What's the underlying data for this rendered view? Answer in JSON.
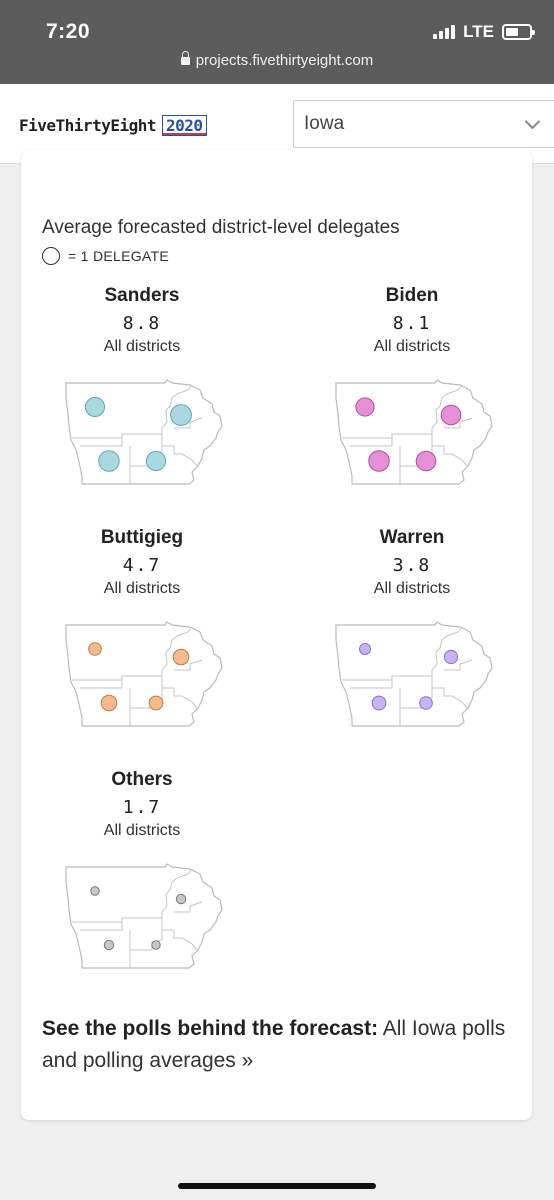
{
  "status_bar": {
    "time": "7:20",
    "network": "LTE",
    "url": "projects.fivethirtyeight.com"
  },
  "header": {
    "logo_text": "FiveThirtyEight",
    "logo_year": "2020",
    "state_selected": "Iowa"
  },
  "card": {
    "heading": "Average forecasted district-level delegates",
    "legend_label": "= 1 DELEGATE",
    "candidates": [
      {
        "name": "Sanders",
        "value": "8.8",
        "sub": "All districts",
        "color": "#a9d8e0",
        "stroke": "#5fa8b8",
        "district_delegates": [
          2.1,
          2.5,
          2.4,
          2.1
        ]
      },
      {
        "name": "Biden",
        "value": "8.1",
        "sub": "All districts",
        "color": "#e58fd4",
        "stroke": "#b34aa0",
        "district_delegates": [
          1.9,
          2.2,
          2.4,
          2.2
        ]
      },
      {
        "name": "Buttigieg",
        "value": "4.7",
        "sub": "All districts",
        "color": "#f3b98f",
        "stroke": "#c77b45",
        "district_delegates": [
          0.9,
          1.4,
          1.4,
          1.1
        ]
      },
      {
        "name": "Warren",
        "value": "3.8",
        "sub": "All districts",
        "color": "#c9b4f3",
        "stroke": "#8b6cd1",
        "district_delegates": [
          0.7,
          1.0,
          1.1,
          0.9
        ]
      },
      {
        "name": "Others",
        "value": "1.7",
        "sub": "All districts",
        "color": "#c8c8c8",
        "stroke": "#777777",
        "district_delegates": [
          0.4,
          0.5,
          0.5,
          0.4
        ]
      }
    ],
    "footer_bold": "See the polls behind the forecast:",
    "footer_link": "All Iowa polls and polling averages »"
  }
}
